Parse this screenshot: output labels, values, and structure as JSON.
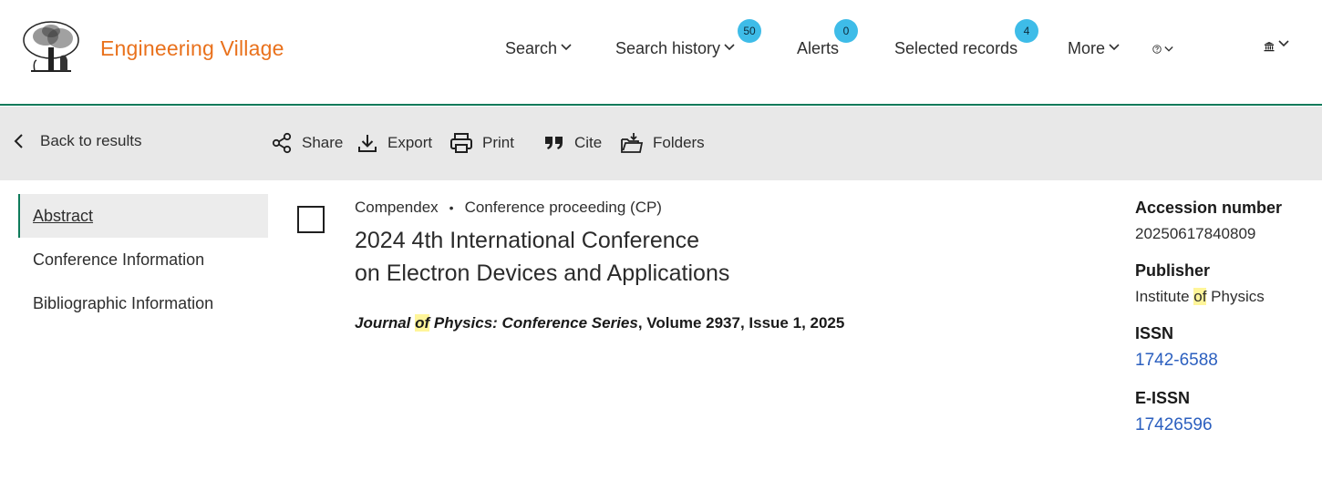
{
  "header": {
    "brand": "Engineering Village",
    "nav": {
      "search": "Search",
      "search_history": "Search history",
      "search_history_badge": "50",
      "alerts": "Alerts",
      "alerts_badge": "0",
      "selected_records": "Selected records",
      "selected_records_badge": "4",
      "more": "More"
    },
    "accent_color": "#e9711c",
    "badge_color": "#3ebce8"
  },
  "toolbar": {
    "back": "Back to results",
    "share": "Share",
    "export": "Export",
    "print": "Print",
    "cite": "Cite",
    "folders": "Folders"
  },
  "sidebar": {
    "items": [
      {
        "label": "Abstract"
      },
      {
        "label": "Conference Information"
      },
      {
        "label": "Bibliographic Information"
      }
    ]
  },
  "record": {
    "database": "Compendex",
    "doc_type": "Conference proceeding (CP)",
    "title_line1": "2024 4th International Conference",
    "title_line2": "on Electron Devices and Applications",
    "source_journal_pre": "Journal ",
    "source_journal_hl": "of",
    "source_journal_post": " Physics: Conference Series",
    "source_rest": ", Volume 2937, Issue 1, 2025"
  },
  "details": {
    "accession_label": "Accession number",
    "accession_value": "20250617840809",
    "publisher_label": "Publisher",
    "publisher_pre": "Institute ",
    "publisher_hl": "of",
    "publisher_post": " Physics",
    "issn_label": "ISSN",
    "issn_value": "1742-6588",
    "eissn_label": "E-ISSN",
    "eissn_value": "17426596"
  }
}
